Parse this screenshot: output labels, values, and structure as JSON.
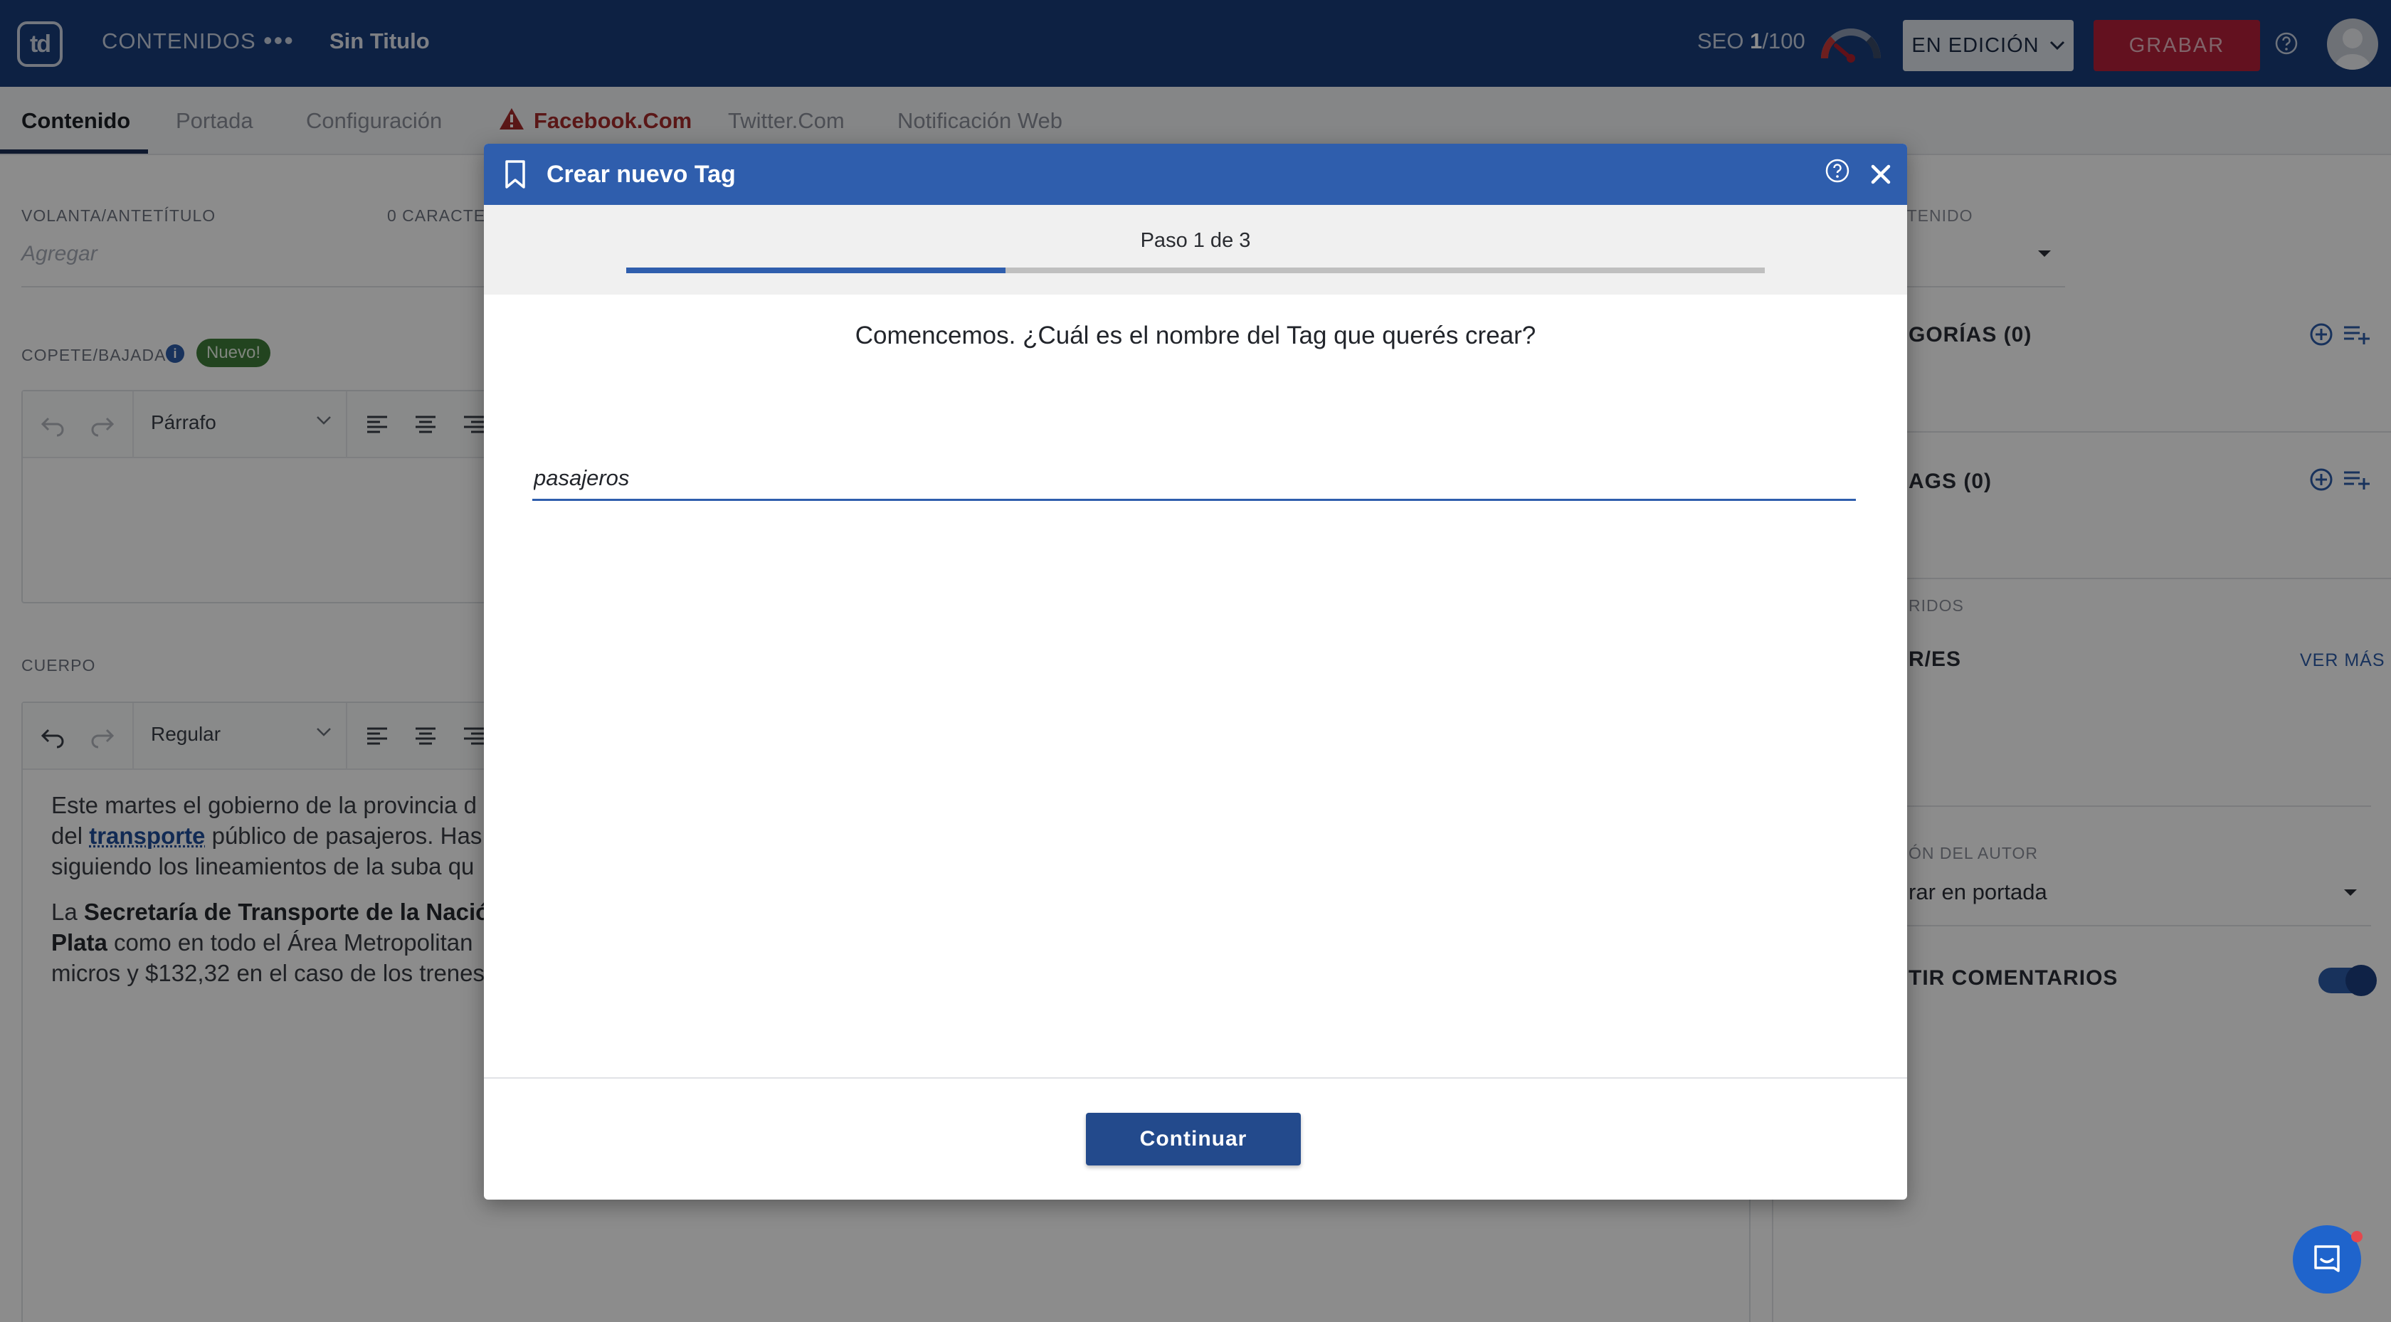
{
  "topbar": {
    "logo_text": "td",
    "section_label": "CONTENIDOS",
    "more_dots": "•••",
    "doc_title": "Sin Titulo",
    "seo_label": "SEO",
    "seo_score": "1",
    "seo_max": "/100",
    "status_label": "EN EDICIÓN",
    "save_label": "GRABAR"
  },
  "tabs": [
    {
      "label": "Contenido"
    },
    {
      "label": "Portada"
    },
    {
      "label": "Configuración"
    },
    {
      "label": "Facebook.Com"
    },
    {
      "label": "Twitter.Com"
    },
    {
      "label": "Notificación Web"
    }
  ],
  "editor": {
    "volanta_label": "VOLANTA/ANTETÍTULO",
    "volanta_counter": "0 CARACTE",
    "volanta_placeholder": "Agregar",
    "copete_label": "COPETE/BAJADA",
    "nuevo_badge": "Nuevo!",
    "copete_style": "Párrafo",
    "cuerpo_label": "CUERPO",
    "cuerpo_style": "Regular",
    "p1_l1": "Este martes el gobierno de la provincia d",
    "p1_l2_a": "del ",
    "p1_l2_link": "transporte",
    "p1_l2_b": " público de pasajeros. Has",
    "p1_l3": "siguiendo los lineamientos de la suba qu",
    "p2_l1_a": "La ",
    "p2_l1_bold": "Secretaría de Transporte de la Nació",
    "p2_l2_bold": "Plata",
    "p2_l2_b": " como en todo el Área Metropolitan",
    "p2_l3": "micros y $132,32 en el caso de los trenes"
  },
  "sidebar": {
    "contenido_label": "NTENIDO",
    "categorias_heading": "GORÍAS (0)",
    "tags_heading": "AGS (0)",
    "favoritos_label": "RIDOS",
    "autores_heading": "R/ES",
    "ver_mas": "VER MÁS",
    "autor_label": "ÓN DEL AUTOR",
    "autor_value": "rar en portada",
    "comentarios_heading": "TIR COMENTARIOS"
  },
  "modal": {
    "title": "Crear nuevo Tag",
    "step_text": "Paso 1 de 3",
    "progress": 0.3333,
    "question": "Comencemos. ¿Cuál es el nombre del Tag que querés crear?",
    "input_value": "pasajeros",
    "continue_label": "Continuar"
  },
  "colors": {
    "navbar": "#193d7a",
    "modal_header": "#2f5ead",
    "primary_button": "#234a8c",
    "save_button": "#b5203a",
    "warning": "#a52a2a"
  },
  "icons": {
    "modal_title_icon": "bookmark-icon",
    "modal_help": "help-circle-icon",
    "modal_close": "close-icon",
    "seo_gauge": "gauge-icon",
    "chat": "chat-icon"
  }
}
